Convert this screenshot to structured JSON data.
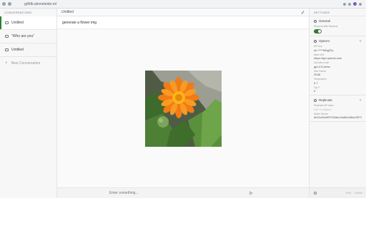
{
  "browser": {
    "url": "gdfdb.alemeteide.ml"
  },
  "sidebar": {
    "title": "CONVERSATIONS",
    "items": [
      {
        "label": "Untitled",
        "active": true
      },
      {
        "label": "\"Who are you\"",
        "active": false
      },
      {
        "label": "Untitled",
        "active": false
      }
    ],
    "new_conversation_label": "New Conversation"
  },
  "main": {
    "title": "Untitled",
    "user_message": "generate a flower img",
    "image_alt": "orange calendula flower",
    "input_placeholder": "Enter something..."
  },
  "settings": {
    "title": "SETTINGS",
    "general": {
      "heading": "General",
      "label": "Respond With Backend",
      "toggle_on": true
    },
    "openai": {
      "heading": "OpenAI",
      "api_key_label": "API Key",
      "api_key_value": "sk-*****Mhg57p",
      "base_url_label": "Base URL",
      "base_url_value": "https://api.openai.com",
      "model_label": "Operate model",
      "model_value": "gpt-3.5-turbo",
      "max_tokens_label": "Max Tokens",
      "max_tokens_value": "2048",
      "temperature_label": "Temperature",
      "temperature_value": "0.7",
      "top_p_label": "Top P",
      "top_p_value": "0"
    },
    "replicate": {
      "heading": "Replicate",
      "api_token_label": "Replicate API token",
      "api_token_value": "Not Configure",
      "model_version_label": "Model Version",
      "model_version_value": "db21e45d3f7023abc2a46ee38a23973..."
    },
    "footer": {
      "link1": "Print",
      "link2": "GitHub"
    }
  },
  "colors": {
    "accent": "#2e7d32"
  }
}
